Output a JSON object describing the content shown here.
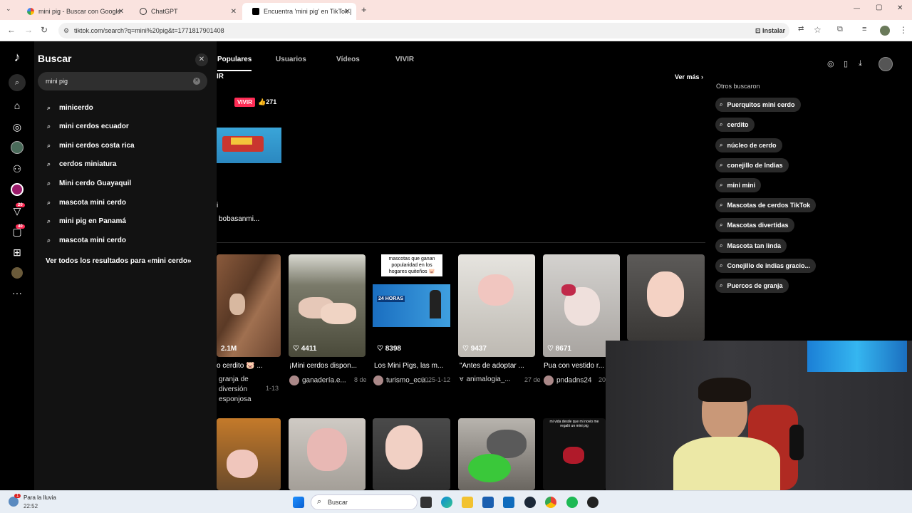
{
  "browser": {
    "tabs": [
      {
        "title": "mini pig - Buscar con Google",
        "active": false
      },
      {
        "title": "ChatGPT",
        "active": false
      },
      {
        "title": "Encuentra 'mini pig' en TikTok |",
        "active": true
      }
    ],
    "new_tab": "+",
    "url": "tiktok.com/search?q=mini%20pig&t=1771817901408",
    "install_label": "Instalar",
    "window_controls": {
      "minimize": "—",
      "maximize": "▢",
      "close": "✕"
    }
  },
  "nav": {
    "badges": {
      "inbox": "20",
      "messages": "40"
    }
  },
  "search_panel": {
    "title": "Buscar",
    "close": "✕",
    "query": "mini pig",
    "suggestions": [
      "minicerdo",
      "mini cerdos ecuador",
      "mini cerdos costa rica",
      "cerdos miniatura",
      "Mini cerdo Guayaquil",
      "mascota mini cerdo",
      "mini pig en Panamá",
      "mascota mini cerdo"
    ],
    "see_all": "Ver todos los resultados para «mini cerdo»"
  },
  "results": {
    "tabs": [
      "Populares",
      "Usuarios",
      "Vídeos",
      "VIVIR"
    ],
    "live_section_fragment": "IR",
    "see_more": "Ver más ›",
    "live_badge": "VIVIR",
    "live_likes": "271",
    "live_user_fragment": "i",
    "live_username": "bobasanmi...",
    "videos": [
      {
        "likes": "2.1M",
        "title": "o cerdito 🐷 ...",
        "user": "granja de diversión esponjosa",
        "date": "1-13"
      },
      {
        "likes": "4411",
        "title": "¡Mini cerdos dispon...",
        "user": "ganadería.e...",
        "date": "8 de"
      },
      {
        "likes": "8398",
        "title": "Los Mini Pigs, las m...",
        "user": "turismo_ecu...",
        "date": "2025-1-12",
        "overlay": "mascotas que ganan popularidad en los hogares quiteños 🐷",
        "logo": "24 HORAS"
      },
      {
        "likes": "9437",
        "title": "\"Antes de adoptar ...",
        "user": "animalogia_...",
        "date": "27 de"
      },
      {
        "likes": "8671",
        "title": "Pua con vestido r...",
        "user": "pndadns24",
        "date": "20"
      },
      {
        "likes": "",
        "title": "",
        "user": "",
        "date": ""
      }
    ],
    "second_row_caption": "mi vida desde que mi novio me regaló un mini pig"
  },
  "related": {
    "title": "Otros buscaron",
    "items": [
      "Puerquitos mini cerdo",
      "cerdito",
      "núcleo de cerdo",
      "conejillo de Indias",
      "mini mini",
      "Mascotas de cerdos TikTok",
      "Mascotas divertidas",
      "Mascota tan linda",
      "Conejillo de indias gracio...",
      "Puercos de granja"
    ]
  },
  "taskbar": {
    "weather": "Para la lluvia",
    "time": "22:52",
    "search_placeholder": "Buscar",
    "notif": "1"
  },
  "colors": {
    "accent": "#fe2c55",
    "panel": "#121212",
    "chip": "#2a2a2a"
  }
}
